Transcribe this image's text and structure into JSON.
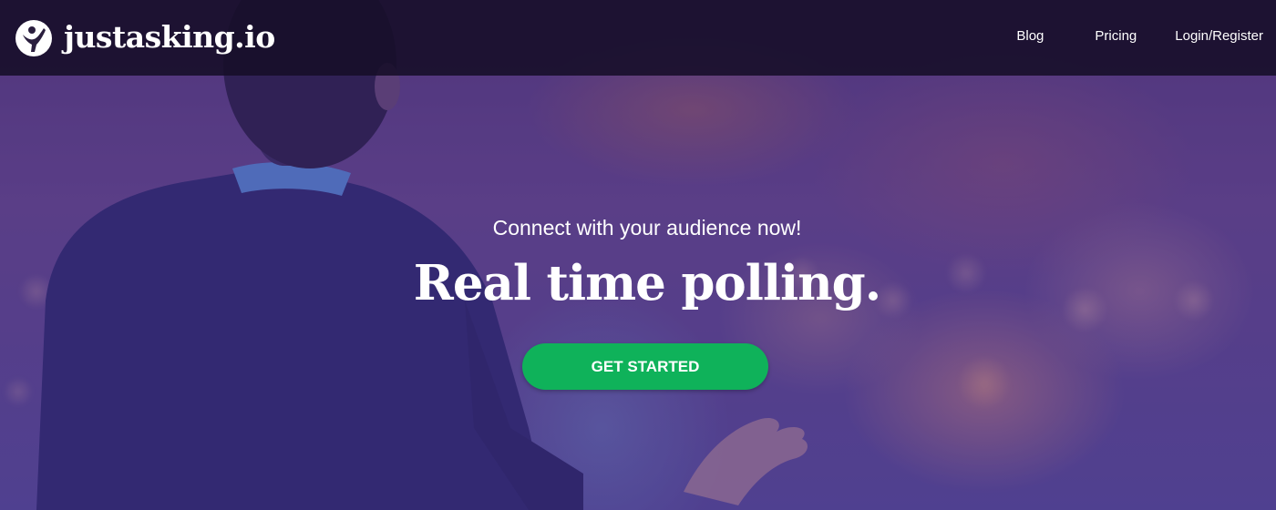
{
  "navbar": {
    "brand_name": "justasking.io",
    "links": {
      "blog": "Blog",
      "pricing": "Pricing",
      "login": "Login/Register"
    }
  },
  "hero": {
    "tagline": "Connect with your audience now!",
    "headline": "Real time polling.",
    "cta_label": "GET STARTED"
  },
  "colors": {
    "cta_green": "#0fb25a",
    "navbar_bg": "#160e28",
    "overlay_purple": "#3c2882"
  },
  "icons": {
    "logo": "justasking-logo-icon"
  }
}
